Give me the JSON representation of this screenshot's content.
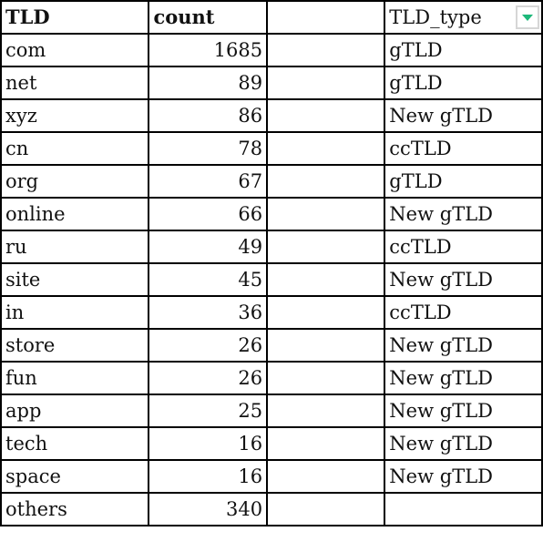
{
  "headers": {
    "tld": "TLD",
    "count": "count",
    "blank": "",
    "tld_type": "TLD_type"
  },
  "filter": {
    "icon": "dropdown-filter-icon",
    "accent_color": "#1db87a"
  },
  "rows": [
    {
      "tld": "com",
      "count": "1685",
      "type": "gTLD"
    },
    {
      "tld": "net",
      "count": "89",
      "type": "gTLD"
    },
    {
      "tld": "xyz",
      "count": "86",
      "type": "New gTLD"
    },
    {
      "tld": "cn",
      "count": "78",
      "type": "ccTLD"
    },
    {
      "tld": "org",
      "count": "67",
      "type": "gTLD"
    },
    {
      "tld": "online",
      "count": "66",
      "type": "New gTLD"
    },
    {
      "tld": "ru",
      "count": "49",
      "type": "ccTLD"
    },
    {
      "tld": "site",
      "count": "45",
      "type": "New gTLD"
    },
    {
      "tld": "in",
      "count": "36",
      "type": "ccTLD"
    },
    {
      "tld": "store",
      "count": "26",
      "type": "New gTLD"
    },
    {
      "tld": "fun",
      "count": "26",
      "type": "New gTLD"
    },
    {
      "tld": "app",
      "count": "25",
      "type": "New gTLD"
    },
    {
      "tld": "tech",
      "count": "16",
      "type": "New gTLD"
    },
    {
      "tld": "space",
      "count": "16",
      "type": "New gTLD"
    },
    {
      "tld": "others",
      "count": "340",
      "type": ""
    }
  ]
}
